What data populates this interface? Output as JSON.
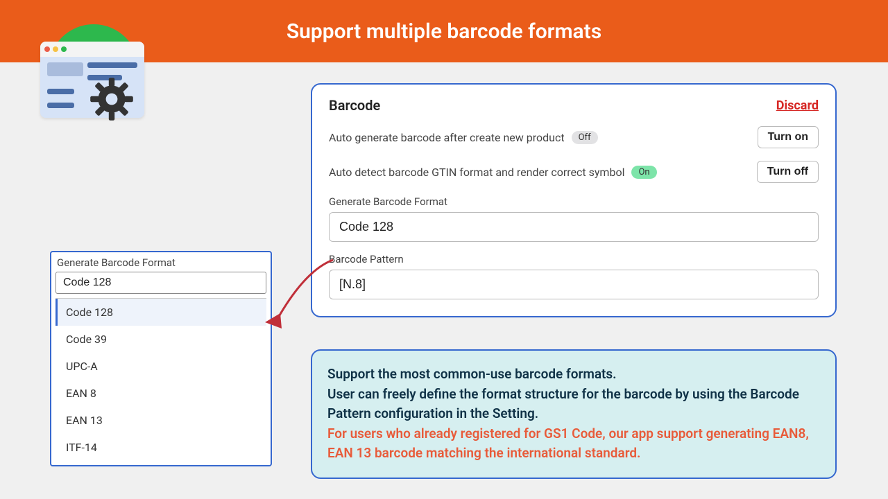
{
  "header": {
    "title": "Support multiple barcode formats"
  },
  "card": {
    "title": "Barcode",
    "discard": "Discard",
    "setting1": {
      "label": "Auto generate barcode after create new product",
      "state": "Off",
      "button": "Turn on"
    },
    "setting2": {
      "label": "Auto detect barcode GTIN format and render correct symbol",
      "state": "On",
      "button": "Turn off"
    },
    "format": {
      "label": "Generate Barcode Format",
      "value": "Code 128"
    },
    "pattern": {
      "label": "Barcode Pattern",
      "value": "[N.8]"
    }
  },
  "dropdown": {
    "label": "Generate Barcode Format",
    "value": "Code 128",
    "options": [
      "Code 128",
      "Code 39",
      "UPC-A",
      "EAN 8",
      "EAN 13",
      "ITF-14"
    ]
  },
  "info": {
    "line1": "Support the most common-use barcode formats.",
    "line2": "User can freely define the format structure for the barcode by using the Barcode Pattern configuration in the Setting.",
    "line3": "For users who already registered for GS1 Code, our app support generating EAN8, EAN 13 barcode matching the international standard."
  }
}
